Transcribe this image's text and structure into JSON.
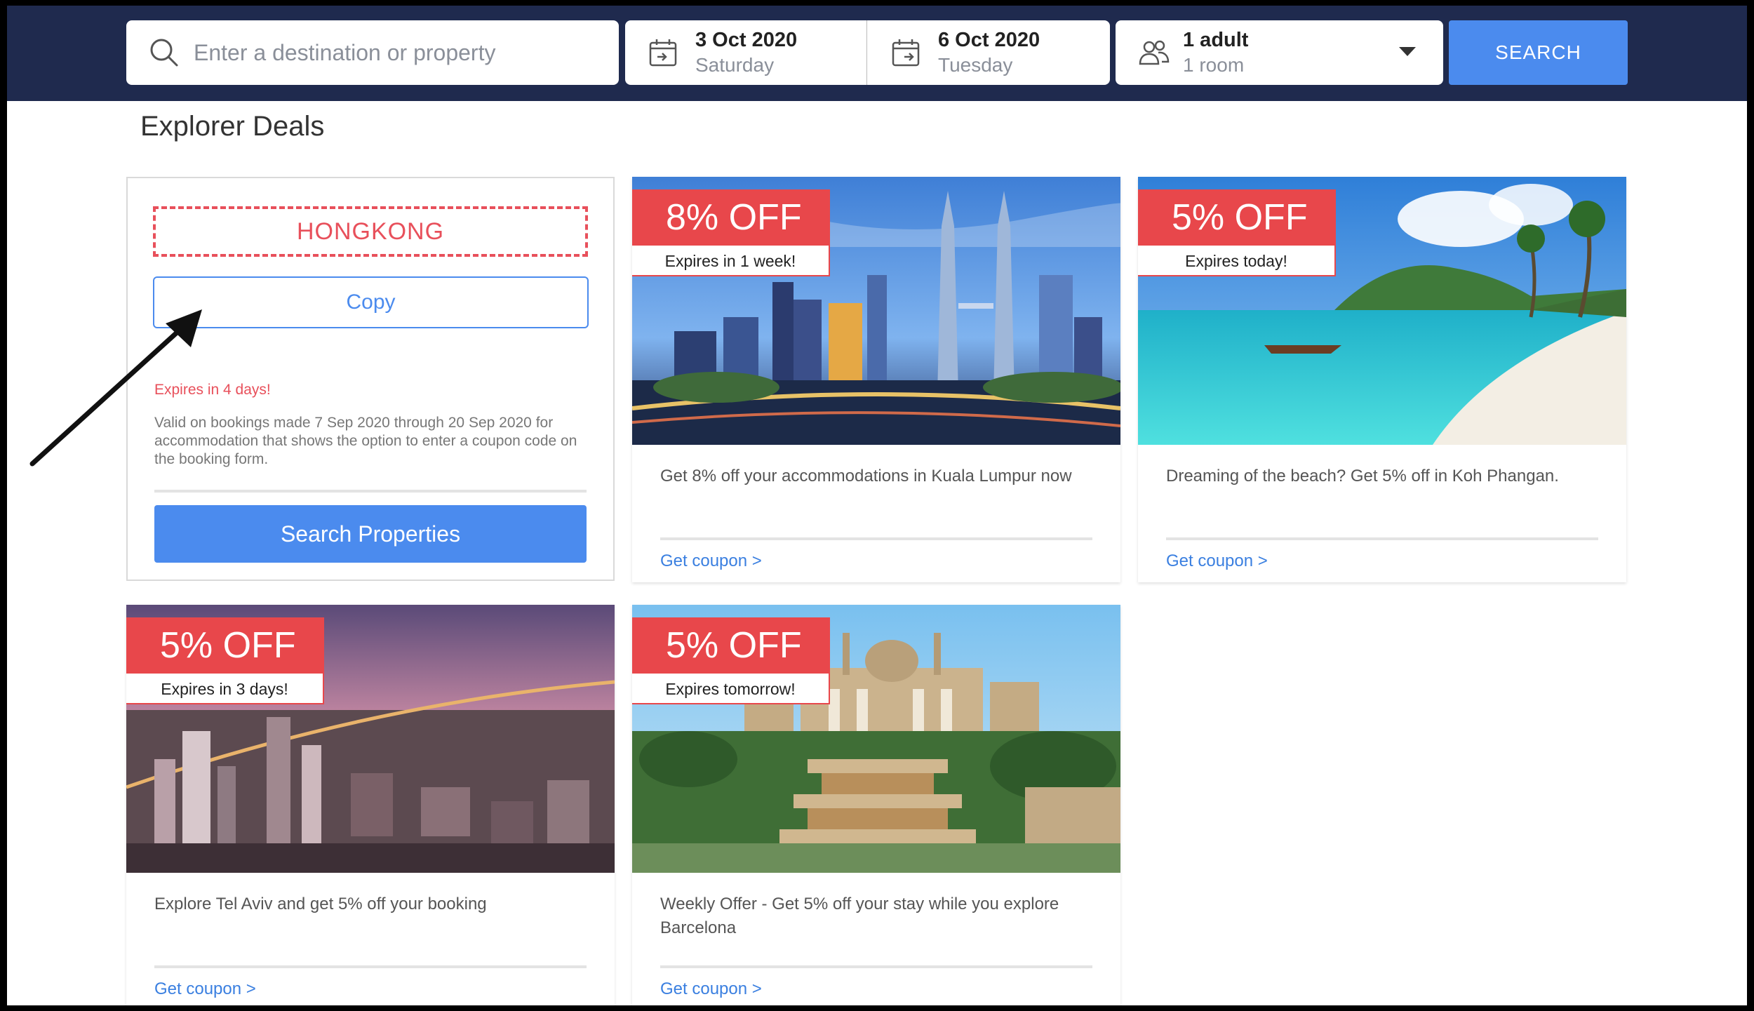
{
  "search": {
    "placeholder": "Enter a destination or property",
    "checkin_date": "3 Oct 2020",
    "checkin_day": "Saturday",
    "checkout_date": "6 Oct 2020",
    "checkout_day": "Tuesday",
    "guests": "1 adult",
    "rooms": "1 room",
    "button": "SEARCH"
  },
  "section_title": "Explorer Deals",
  "coupon": {
    "code": "HONGKONG",
    "copy_label": "Copy",
    "expires": "Expires in 4 days!",
    "validity": "Valid on bookings made 7 Sep 2020 through 20 Sep 2020 for accommodation that shows the option to enter a coupon code on the booking form.",
    "search_properties_label": "Search Properties"
  },
  "deals": [
    {
      "discount": "8% OFF",
      "expires": "Expires in 1 week!",
      "description": "Get 8% off your accommodations in Kuala Lumpur now",
      "link": "Get coupon >"
    },
    {
      "discount": "5% OFF",
      "expires": "Expires today!",
      "description": "Dreaming of the beach? Get 5% off in Koh Phangan.",
      "link": "Get coupon >"
    },
    {
      "discount": "5% OFF",
      "expires": "Expires in 3 days!",
      "description": "Explore Tel Aviv and get 5% off your booking",
      "link": "Get coupon >"
    },
    {
      "discount": "5% OFF",
      "expires": "Expires tomorrow!",
      "description": "Weekly Offer - Get 5% off your stay while you explore Barcelona",
      "link": "Get coupon >"
    }
  ],
  "colors": {
    "header_bg": "#1f2a4e",
    "accent_blue": "#4b8bee",
    "badge_red": "#e8474b"
  }
}
